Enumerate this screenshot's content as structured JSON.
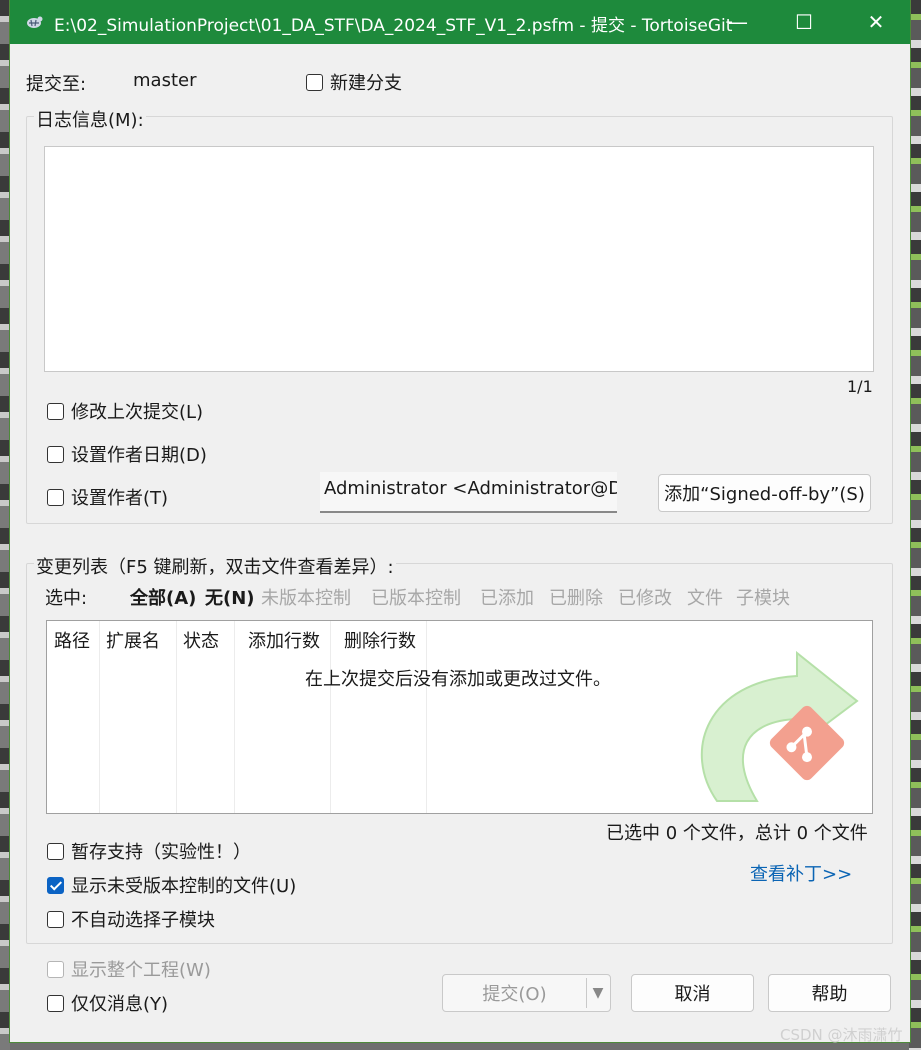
{
  "window": {
    "title": "E:\\02_SimulationProject\\01_DA_STF\\DA_2024_STF_V1_2.psfm - 提交 - TortoiseGit",
    "minimize": "—",
    "maximize": "☐",
    "close": "✕"
  },
  "commit_to": {
    "label": "提交至:",
    "branch": "master",
    "new_branch_label": "新建分支"
  },
  "log": {
    "group_title": "日志信息(M):",
    "message": "",
    "line_counter": "1/1",
    "amend_label": "修改上次提交(L)",
    "set_date_label": "设置作者日期(D)",
    "set_author_label": "设置作者(T)",
    "author_value": "Administrator <Administrator@DESKTOP",
    "signed_off_button": "添加“Signed-off-by”(S)"
  },
  "changes": {
    "group_title": "变更列表（F5 键刷新，双击文件查看差异）:",
    "select_label": "选中:",
    "filters_active": [
      "全部(A)",
      "无(N)"
    ],
    "filters_inactive": [
      "未版本控制",
      "已版本控制",
      "已添加",
      "已删除",
      "已修改",
      "文件",
      "子模块"
    ],
    "columns": [
      "路径",
      "扩展名",
      "状态",
      "添加行数",
      "删除行数"
    ],
    "empty_message": "在上次提交后没有添加或更改过文件。",
    "summary": "已选中 0 个文件，总计 0 个文件",
    "view_patch_link": "查看补丁>>",
    "stash_label": "暂存支持（实验性！）",
    "show_unversioned_label": "显示未受版本控制的文件(U)",
    "no_auto_submodule_label": "不自动选择子模块"
  },
  "footer": {
    "show_whole_project_label": "显示整个工程(W)",
    "message_only_label": "仅仅消息(Y)",
    "commit_button": "提交(O)",
    "cancel_button": "取消",
    "help_button": "帮助"
  },
  "watermark": "CSDN @沐雨潇竹",
  "colors": {
    "titlebar": "#1e8a3c",
    "accent": "#0b63c4",
    "link": "#0a64b4"
  }
}
